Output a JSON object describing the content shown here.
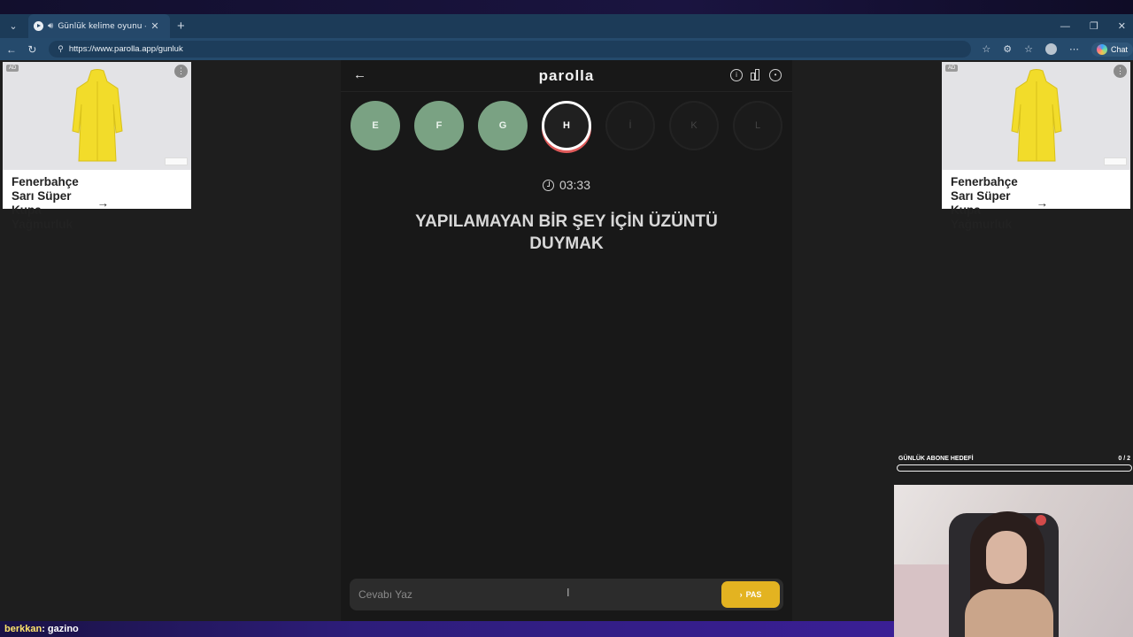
{
  "browser": {
    "tab_title": "Günlük kelime oyunu - parol...",
    "url": "https://www.parolla.app/gunluk",
    "chat_label": "Chat"
  },
  "ads": [
    {
      "badge": "AD",
      "title": "Fenerbahçe Sarı Süper Kupa Yağmurluk"
    },
    {
      "badge": "AD",
      "title": "Fenerbahçe Sarı Süper Kupa Yağmurluk"
    }
  ],
  "game": {
    "logo": "parolla",
    "letters": [
      {
        "letter": "E",
        "state": "done"
      },
      {
        "letter": "F",
        "state": "done"
      },
      {
        "letter": "G",
        "state": "done"
      },
      {
        "letter": "H",
        "state": "active"
      },
      {
        "letter": "İ",
        "state": "pending"
      },
      {
        "letter": "K",
        "state": "pending"
      },
      {
        "letter": "L",
        "state": "pending"
      }
    ],
    "timer": "03:33",
    "question": "YAPILAMAYAN BİR ŞEY İÇİN ÜZÜNTÜ DUYMAK",
    "answer_placeholder": "Cevabı Yaz",
    "pass_label": "PAS"
  },
  "overlay": {
    "goal_label": "GÜNLÜK ABONE HEDEFİ",
    "goal_count": "0 / 2",
    "chat_user": "berkkan",
    "chat_message": ": gazino"
  },
  "colors": {
    "done": "#7aa283",
    "pass_button": "#e3b321",
    "active_ring": "#ffffff"
  }
}
